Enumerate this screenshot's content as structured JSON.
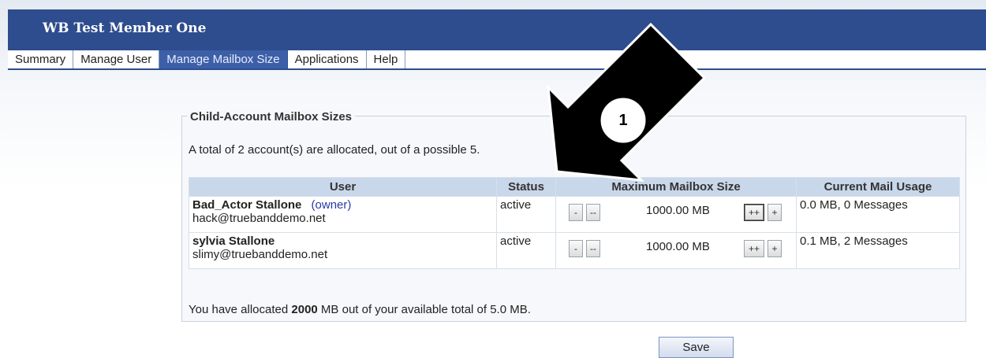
{
  "header": {
    "title": "WB Test Member One"
  },
  "tabs": [
    {
      "label": "Summary"
    },
    {
      "label": "Manage User"
    },
    {
      "label": "Manage Mailbox Size",
      "active": true
    },
    {
      "label": "Applications"
    },
    {
      "label": "Help"
    }
  ],
  "panel": {
    "legend": "Child-Account Mailbox Sizes",
    "allocation_text": "A total of 2 account(s) are allocated, out of a possible 5.",
    "columns": [
      "User",
      "Status",
      "Maximum Mailbox Size",
      "Current Mail Usage"
    ],
    "rows": [
      {
        "name": "Bad_Actor Stallone",
        "tag": "(owner)",
        "email": "hack@truebanddemo.net",
        "status": "active",
        "size": "1000.00 MB",
        "usage": "0.0 MB, 0 Messages"
      },
      {
        "name": "sylvia Stallone",
        "tag": "",
        "email": "slimy@truebanddemo.net",
        "status": "active",
        "size": "1000.00 MB",
        "usage": "0.1 MB, 2 Messages"
      }
    ],
    "buttons": {
      "minus": "-",
      "minus_big": "--",
      "plus_big": "++",
      "plus": "+"
    },
    "summary": {
      "prefix": "You have allocated ",
      "amount": "2000",
      "suffix": " MB out of your available total of 5.0 MB."
    }
  },
  "save_label": "Save",
  "annotation": {
    "number": "1",
    "arrow_color": "#000000"
  }
}
